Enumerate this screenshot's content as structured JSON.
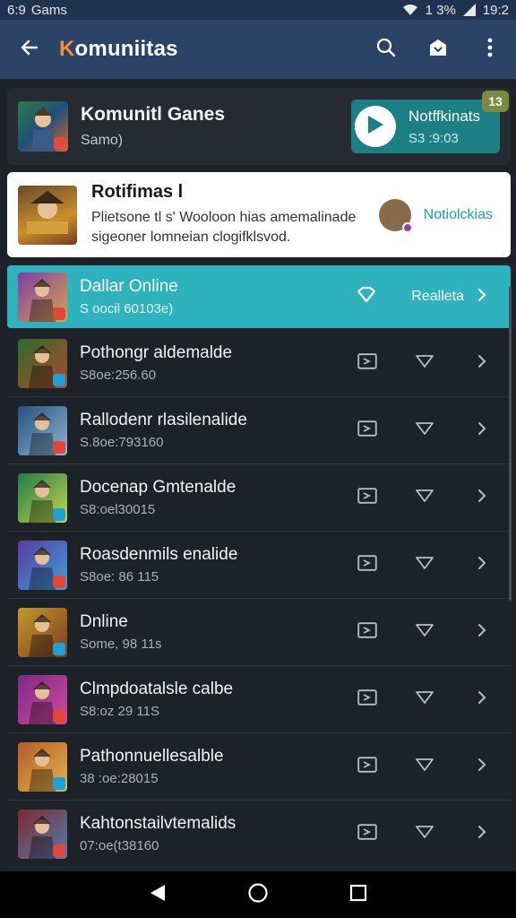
{
  "status_bar": {
    "left_text": "6:9",
    "app_name": "Gams",
    "battery_text": "1 3%",
    "time": "19:2"
  },
  "app_bar": {
    "title_accent": "K",
    "title_rest": "omuniitas"
  },
  "hero": {
    "title": "Komunitl Ganes",
    "subtitle": "Samo)",
    "notif_title": "Notffkinats",
    "notif_sub": "S3 :9:03",
    "notif_count": "13"
  },
  "promo": {
    "title": "Rotifimas l",
    "line1": "Plietsone tl s' Wooloon hias amemalinade",
    "line2": "sigeoner lomneian clogifklsvod.",
    "link": "Notiolckias"
  },
  "games": [
    {
      "title": "Dallar Online",
      "subtitle": "S oocil 60103e)",
      "link": "Realleta",
      "active": true,
      "colors": [
        "#7a3fa8",
        "#e0a14a"
      ]
    },
    {
      "title": "Pothongr aldemalde",
      "subtitle": "S8oe:256.60",
      "colors": [
        "#2d6b2b",
        "#b04a2a"
      ]
    },
    {
      "title": "Rallodenr rlasilenalide",
      "subtitle": "S.8oe:793160",
      "colors": [
        "#24507a",
        "#8fb6d6"
      ]
    },
    {
      "title": "Docenap Gmtenalde",
      "subtitle": "S8:oel30015",
      "colors": [
        "#1f7a4a",
        "#c7d64a"
      ]
    },
    {
      "title": "Roasdenmils enalide",
      "subtitle": "S8oe: 86 115",
      "colors": [
        "#5b3aa0",
        "#3ea0d6"
      ]
    },
    {
      "title": "Dnline",
      "subtitle": "Some, 98 11s",
      "colors": [
        "#c49a2a",
        "#7a3a1f"
      ]
    },
    {
      "title": "Clmpdoatalsle calbe",
      "subtitle": "S8:oz 29 11S",
      "colors": [
        "#7a2a8a",
        "#d44a9a"
      ]
    },
    {
      "title": "Pathonnuellesalble",
      "subtitle": "38 :oe:28015",
      "colors": [
        "#b45a2a",
        "#e6b44a"
      ]
    },
    {
      "title": "Kahtonstailvtemalids",
      "subtitle": "07:oe(t38160",
      "colors": [
        "#7a2a2a",
        "#5a7ab4"
      ]
    }
  ],
  "icons": {
    "back": "arrow-left-icon",
    "search": "search-icon",
    "store": "store-icon",
    "more": "more-vert-icon",
    "play": "play-icon",
    "download": "download-icon",
    "favorite": "heart-outline-icon",
    "chevron": "chevron-right-icon",
    "nav_back": "nav-back-icon",
    "nav_home": "nav-home-icon",
    "nav_recents": "nav-recents-icon"
  },
  "colors": {
    "app_bar": "#2a4366",
    "active_row": "#2eb2bd",
    "notif_card": "#1c7f83",
    "accent": "#ff8a3a"
  }
}
